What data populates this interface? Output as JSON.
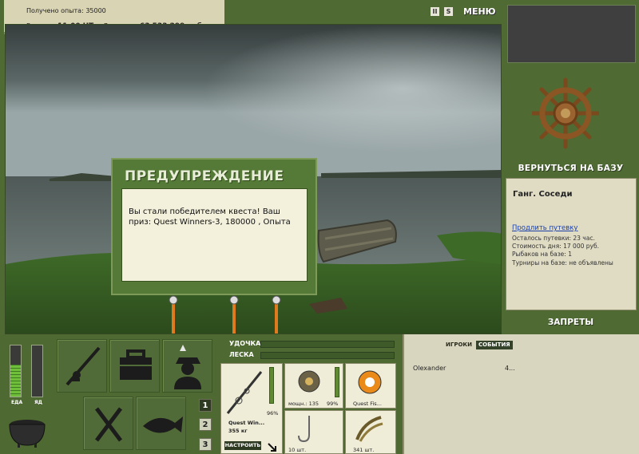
{
  "status": {
    "experience": "Получено опыта: 35000",
    "time_label": "Время:",
    "time_value": "11:00 ЧТ",
    "money_label": "Деньги:",
    "money_value": "63 533 299 руб."
  },
  "topbar": {
    "pause": "II",
    "sound": "S",
    "menu": "МЕНЮ"
  },
  "dialog": {
    "title": "ПРЕДУПРЕЖДЕНИЕ",
    "message": "Вы стали победителем квеста! Ваш приз: Quest Winners-3, 180000 , Опыта"
  },
  "base": {
    "return_label": "ВЕРНУТЬСЯ НА БАЗУ",
    "name": "Ганг. Соседи",
    "extend_link": "Продлить путевку",
    "trip_left": "Осталось путевки: 23 час.",
    "day_cost": "Стоимость дня: 17 000 руб.",
    "fishers": "Рыбаков на базе: 1",
    "tournaments": "Турниры на базе: не объявлены",
    "bans_label": "ЗАПРЕТЫ"
  },
  "needs": {
    "food_label": "ЕДА",
    "food_level": 0.62,
    "poison_label": "ЯД",
    "poison_level": 0.0
  },
  "tabs_numbers": [
    "1",
    "2",
    "3"
  ],
  "tackle": {
    "rod_label": "УДОЧКА",
    "line_label": "ЛЕСКА",
    "rod_name": "Quest Win...",
    "rod_weight": "355 кг",
    "rod_percent": "96%",
    "adjust_label": "НАСТРОИТЬ",
    "reel_caption": "мощн.: 135",
    "reel_percent": "99%",
    "line_caption": "Quest Fis...",
    "hook_caption": "10 шт.",
    "bait_caption": "341 шт."
  },
  "events": {
    "tab_players": "ИГРОКИ",
    "tab_events": "СОБЫТИЯ",
    "rows": [
      {
        "name": "Olexander",
        "value": "4..."
      }
    ]
  },
  "colors": {
    "panel_green": "#4f6a33",
    "food_fill": "#6fbf3b",
    "dialog_bg": "#557a37"
  }
}
